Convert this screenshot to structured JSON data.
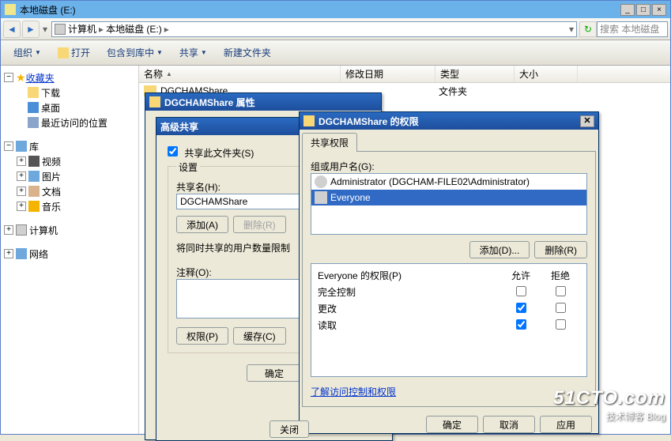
{
  "window": {
    "title": "本地磁盘 (E:)",
    "min": "_",
    "max": "□",
    "close": "×"
  },
  "nav": {
    "back": "◄",
    "fwd": "►",
    "drop": "▾",
    "refresh": "↻"
  },
  "breadcrumb": {
    "computer": "计算机",
    "drive": "本地磁盘 (E:)",
    "sep": "▸"
  },
  "search": {
    "placeholder": "搜索 本地磁盘"
  },
  "toolbar": {
    "organize": "组织",
    "open": "打开",
    "include": "包含到库中",
    "share": "共享",
    "newfolder": "新建文件夹"
  },
  "tree": {
    "favorites": "收藏夹",
    "downloads": "下载",
    "desktop": "桌面",
    "recent": "最近访问的位置",
    "libraries": "库",
    "videos": "视频",
    "pictures": "图片",
    "documents": "文档",
    "music": "音乐",
    "computer": "计算机",
    "network": "网络",
    "plus": "+",
    "minus": "−"
  },
  "columns": {
    "name": "名称",
    "modified": "修改日期",
    "type": "类型",
    "size": "大小"
  },
  "row": {
    "name": "DGCHAMShare",
    "type": "文件夹"
  },
  "dlg_props": {
    "title": "DGCHAMShare 属性"
  },
  "dlg_adv": {
    "title": "高级共享",
    "share_chk": "共享此文件夹(S)",
    "settings": "设置",
    "sharename": "共享名(H):",
    "sharename_val": "DGCHAMShare",
    "add": "添加(A)",
    "remove": "删除(R)",
    "limit": "将同时共享的用户数量限制",
    "notes": "注释(O):",
    "perm": "权限(P)",
    "cache": "缓存(C)",
    "ok": "确定"
  },
  "dlg_perm": {
    "title": "DGCHAMShare 的权限",
    "tab": "共享权限",
    "group_label": "组或用户名(G):",
    "users": [
      {
        "name": "Administrator (DGCHAM-FILE02\\Administrator)",
        "icon": "user"
      },
      {
        "name": "Everyone",
        "icon": "group",
        "selected": true
      }
    ],
    "add": "添加(D)...",
    "remove": "删除(R)",
    "perm_for": "Everyone 的权限(P)",
    "allow": "允许",
    "deny": "拒绝",
    "perms": [
      {
        "label": "完全控制",
        "allow": false,
        "deny": false
      },
      {
        "label": "更改",
        "allow": true,
        "deny": false
      },
      {
        "label": "读取",
        "allow": true,
        "deny": false
      }
    ],
    "learn": "了解访问控制和权限",
    "ok": "确定",
    "cancel": "取消",
    "apply": "应用"
  },
  "partial_btn": "关闭",
  "watermark": {
    "big": "51CTO.com",
    "small": "技术博客  Blog"
  }
}
